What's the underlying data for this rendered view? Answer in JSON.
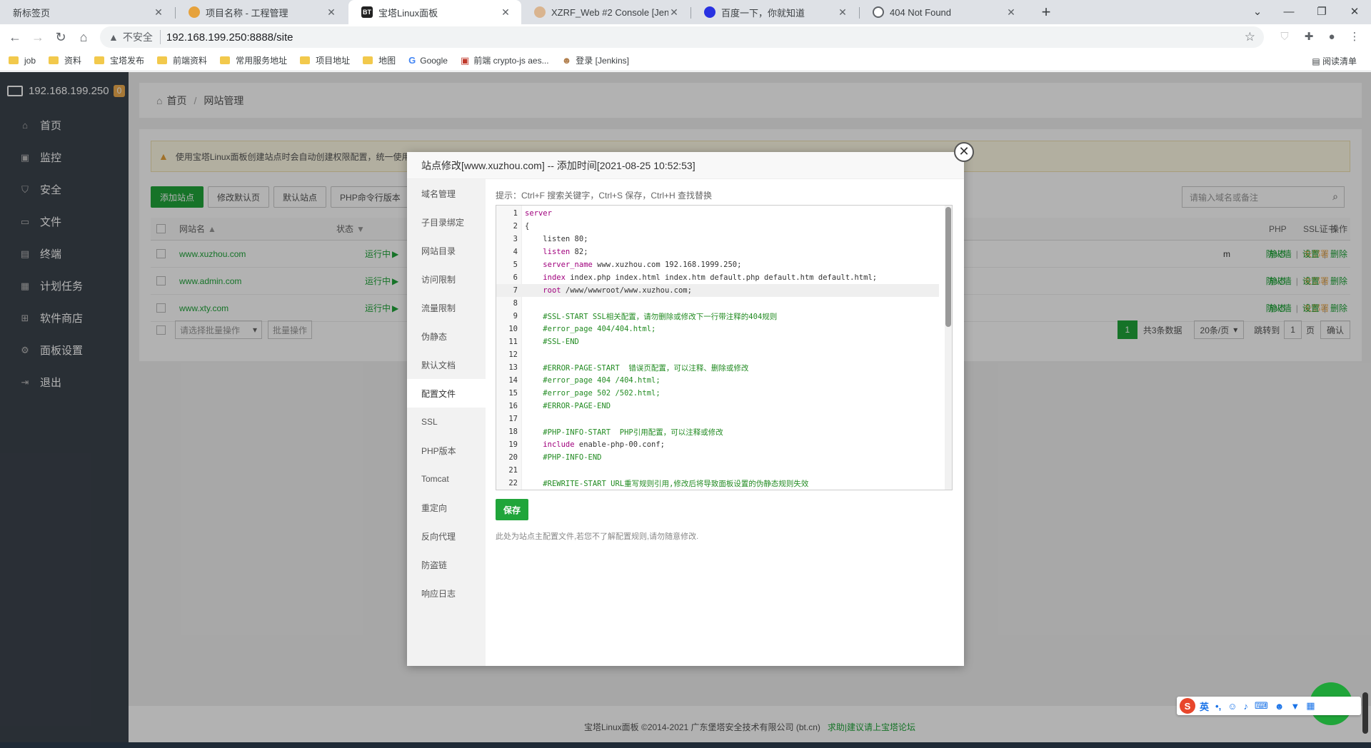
{
  "browser": {
    "tabs": [
      {
        "title": "新标签页",
        "favicon": ""
      },
      {
        "title": "项目名称 - 工程管理",
        "favicon": "project"
      },
      {
        "title": "宝塔Linux面板",
        "favicon": "BT"
      },
      {
        "title": "XZRF_Web #2 Console [Jenkins]",
        "favicon": "jenkins"
      },
      {
        "title": "百度一下，你就知道",
        "favicon": "baidu"
      },
      {
        "title": "404 Not Found",
        "favicon": "globe"
      }
    ],
    "insecure_label": "不安全",
    "url": "192.168.199.250:8888/site",
    "bookmarks": [
      "job",
      "资料",
      "宝塔发布",
      "前端资料",
      "常用服务地址",
      "项目地址",
      "地图",
      "Google",
      "前端 crypto-js aes...",
      "登录 [Jenkins]"
    ],
    "reading_list": "阅读清单"
  },
  "sidebar": {
    "host": "192.168.199.250",
    "badge": "0",
    "items": [
      {
        "label": "首页",
        "icon": "home-icon"
      },
      {
        "label": "监控",
        "icon": "monitor-icon"
      },
      {
        "label": "安全",
        "icon": "shield-icon"
      },
      {
        "label": "文件",
        "icon": "folder-icon"
      },
      {
        "label": "终端",
        "icon": "terminal-icon"
      },
      {
        "label": "计划任务",
        "icon": "calendar-icon"
      },
      {
        "label": "软件商店",
        "icon": "grid-icon"
      },
      {
        "label": "面板设置",
        "icon": "gear-icon"
      },
      {
        "label": "退出",
        "icon": "logout-icon"
      }
    ]
  },
  "breadcrumb": {
    "home": "首页",
    "current": "网站管理"
  },
  "notice": "使用宝塔Linux面板创建站点时会自动创建权限配置，统一使用",
  "toolbar": {
    "add_site": "添加站点",
    "modify_default_page": "修改默认页",
    "default_site": "默认站点",
    "php_cli_version": "PHP命令行版本",
    "search_placeholder": "请输入域名或备注"
  },
  "table": {
    "headers": {
      "site": "网站名",
      "status": "状态",
      "php": "PHP",
      "ssl": "SSL证书",
      "ops": "操作"
    },
    "rows": [
      {
        "site": "www.xuzhou.com",
        "status": "运行中",
        "note": "m",
        "php": "静态",
        "ssl": "未部署"
      },
      {
        "site": "www.admin.com",
        "status": "运行中",
        "note": "",
        "php": "静态",
        "ssl": "未部署"
      },
      {
        "site": "www.xty.com",
        "status": "运行中",
        "note": "",
        "php": "静态",
        "ssl": "未部署"
      }
    ],
    "ops": {
      "firewall": "防火墙",
      "settings": "设置",
      "delete": "删除"
    },
    "batch_select": "请选择批量操作",
    "batch_button": "批量操作",
    "pagination": {
      "current": "1",
      "total_text": "共3条数据",
      "per_page": "20条/页",
      "jump_label": "跳转到",
      "jump_value": "1",
      "page_unit": "页",
      "confirm": "确认"
    }
  },
  "footer": {
    "copyright": "宝塔Linux面板 ©2014-2021 广东堡塔安全技术有限公司 (bt.cn)",
    "help_link": "求助|建议请上宝塔论坛"
  },
  "modal": {
    "title": "站点修改[www.xuzhou.com] -- 添加时间[2021-08-25 10:52:53]",
    "nav": [
      "域名管理",
      "子目录绑定",
      "网站目录",
      "访问限制",
      "流量限制",
      "伪静态",
      "默认文档",
      "配置文件",
      "SSL",
      "PHP版本",
      "Tomcat",
      "重定向",
      "反向代理",
      "防盗链",
      "响应日志"
    ],
    "active_nav": "配置文件",
    "tip": "提示：Ctrl+F 搜索关键字，Ctrl+S 保存，Ctrl+H 查找替换",
    "code_lines": [
      {
        "n": "1",
        "kw": "server",
        "rest": "",
        "indent": "",
        "type": "kw"
      },
      {
        "n": "2",
        "kw": "",
        "rest": "{",
        "indent": "",
        "type": "plain"
      },
      {
        "n": "3",
        "kw": "",
        "rest": "listen 80;",
        "indent": "    ",
        "type": "plain"
      },
      {
        "n": "4",
        "kw": "listen",
        "rest": " 82;",
        "indent": "    ",
        "type": "kw"
      },
      {
        "n": "5",
        "kw": "server_name",
        "rest": " www.xuzhou.com 192.168.1999.250;",
        "indent": "    ",
        "type": "kw"
      },
      {
        "n": "6",
        "kw": "index",
        "rest": " index.php index.html index.htm default.php default.htm default.html;",
        "indent": "    ",
        "type": "kw"
      },
      {
        "n": "7",
        "kw": "root",
        "rest": " /www/wwwroot/www.xuzhou.com;",
        "indent": "    ",
        "type": "kw"
      },
      {
        "n": "8",
        "kw": "",
        "rest": "",
        "indent": "",
        "type": "plain"
      },
      {
        "n": "9",
        "kw": "",
        "rest": "#SSL-START SSL相关配置，请勿删除或修改下一行带注释的404规则",
        "indent": "    ",
        "type": "cmt"
      },
      {
        "n": "10",
        "kw": "",
        "rest": "#error_page 404/404.html;",
        "indent": "    ",
        "type": "cmt"
      },
      {
        "n": "11",
        "kw": "",
        "rest": "#SSL-END",
        "indent": "    ",
        "type": "cmt"
      },
      {
        "n": "12",
        "kw": "",
        "rest": "",
        "indent": "",
        "type": "plain"
      },
      {
        "n": "13",
        "kw": "",
        "rest": "#ERROR-PAGE-START  错误页配置，可以注释、删除或修改",
        "indent": "    ",
        "type": "cmt"
      },
      {
        "n": "14",
        "kw": "",
        "rest": "#error_page 404 /404.html;",
        "indent": "    ",
        "type": "cmt"
      },
      {
        "n": "15",
        "kw": "",
        "rest": "#error_page 502 /502.html;",
        "indent": "    ",
        "type": "cmt"
      },
      {
        "n": "16",
        "kw": "",
        "rest": "#ERROR-PAGE-END",
        "indent": "    ",
        "type": "cmt"
      },
      {
        "n": "17",
        "kw": "",
        "rest": "",
        "indent": "",
        "type": "plain"
      },
      {
        "n": "18",
        "kw": "",
        "rest": "#PHP-INFO-START  PHP引用配置，可以注释或修改",
        "indent": "    ",
        "type": "cmt"
      },
      {
        "n": "19",
        "kw": "include",
        "rest": " enable-php-00.conf;",
        "indent": "    ",
        "type": "kw"
      },
      {
        "n": "20",
        "kw": "",
        "rest": "#PHP-INFO-END",
        "indent": "    ",
        "type": "cmt"
      },
      {
        "n": "21",
        "kw": "",
        "rest": "",
        "indent": "",
        "type": "plain"
      },
      {
        "n": "22",
        "kw": "",
        "rest": "#REWRITE-START URL重写规则引用,修改后将导致面板设置的伪静态规则失效",
        "indent": "    ",
        "type": "cmt"
      }
    ],
    "save": "保存",
    "help": "此处为站点主配置文件,若您不了解配置规则,请勿随意修改."
  },
  "widgets": {
    "help_bubble": "客服",
    "ime": {
      "logo": "S",
      "mode": "英"
    }
  },
  "colors": {
    "accent": "#20a53a",
    "sidebar": "#3c444d",
    "warning": "#f0ad4e"
  }
}
